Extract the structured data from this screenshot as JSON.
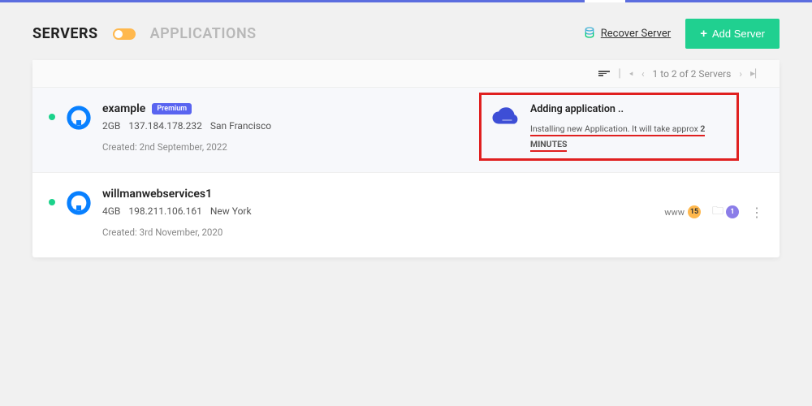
{
  "header": {
    "tabs": {
      "servers": "SERVERS",
      "applications": "APPLICATIONS"
    },
    "recover": "Recover Server",
    "add_server": "Add Server"
  },
  "listbar": {
    "range": "1 to 2 of 2 Servers"
  },
  "servers": [
    {
      "name": "example",
      "badge": "Premium",
      "ram": "2GB",
      "ip": "137.184.178.232",
      "location": "San Francisco",
      "created": "Created: 2nd September, 2022"
    },
    {
      "name": "willmanwebservices1",
      "ram": "4GB",
      "ip": "198.211.106.161",
      "location": "New York",
      "created": "Created: 3rd November, 2020",
      "www_count": "15",
      "folder_count": "1"
    }
  ],
  "notice": {
    "title": "Adding application ..",
    "sub_pre": "Installing new Application. It will take approx ",
    "sub_bold": "2 MINUTES"
  },
  "labels": {
    "www": "www"
  }
}
